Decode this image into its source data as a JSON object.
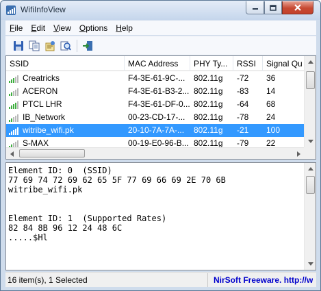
{
  "window": {
    "title": "WifiInfoView"
  },
  "menu": [
    {
      "acc": "F",
      "rest": "ile"
    },
    {
      "acc": "E",
      "rest": "dit"
    },
    {
      "acc": "V",
      "rest": "iew"
    },
    {
      "acc": "O",
      "rest": "ptions"
    },
    {
      "acc": "H",
      "rest": "elp"
    }
  ],
  "toolbar": {
    "buttons": [
      "save-icon",
      "copy-icon",
      "properties-icon",
      "find-icon",
      "exit-icon"
    ]
  },
  "list": {
    "columns": [
      "SSID",
      "MAC Address",
      "PHY Ty...",
      "RSSI",
      "Signal Qu"
    ],
    "rows": [
      {
        "ssid": "Creatricks",
        "mac": "F4-3E-61-9C-...",
        "phy": "802.11g",
        "rssi": "-72",
        "signal": "36",
        "bars": 3
      },
      {
        "ssid": "ACERON",
        "mac": "F4-3E-61-B3-2...",
        "phy": "802.11g",
        "rssi": "-83",
        "signal": "14",
        "bars": 2
      },
      {
        "ssid": "PTCL LHR",
        "mac": "F4-3E-61-DF-0...",
        "phy": "802.11g",
        "rssi": "-64",
        "signal": "68",
        "bars": 4
      },
      {
        "ssid": "IB_Network",
        "mac": "00-23-CD-17-...",
        "phy": "802.11g",
        "rssi": "-78",
        "signal": "24",
        "bars": 2
      },
      {
        "ssid": "witribe_wifi.pk",
        "mac": "20-10-7A-7A-...",
        "phy": "802.11g",
        "rssi": "-21",
        "signal": "100",
        "bars": 5,
        "selected": true
      },
      {
        "ssid": "S-MAX",
        "mac": "00-19-E0-96-B...",
        "phy": "802.11g",
        "rssi": "-79",
        "signal": "22",
        "bars": 2
      }
    ]
  },
  "details": {
    "lines": [
      "Element ID: 0  (SSID)",
      "77 69 74 72 69 62 65 5F 77 69 66 69 2E 70 6B",
      "witribe_wifi.pk",
      "",
      "",
      "Element ID: 1  (Supported Rates)",
      "82 84 8B 96 12 24 48 6C",
      ".....$Hl"
    ]
  },
  "status": {
    "count": "16 item(s), 1 Selected",
    "credit": "NirSoft Freeware.  http://w"
  }
}
